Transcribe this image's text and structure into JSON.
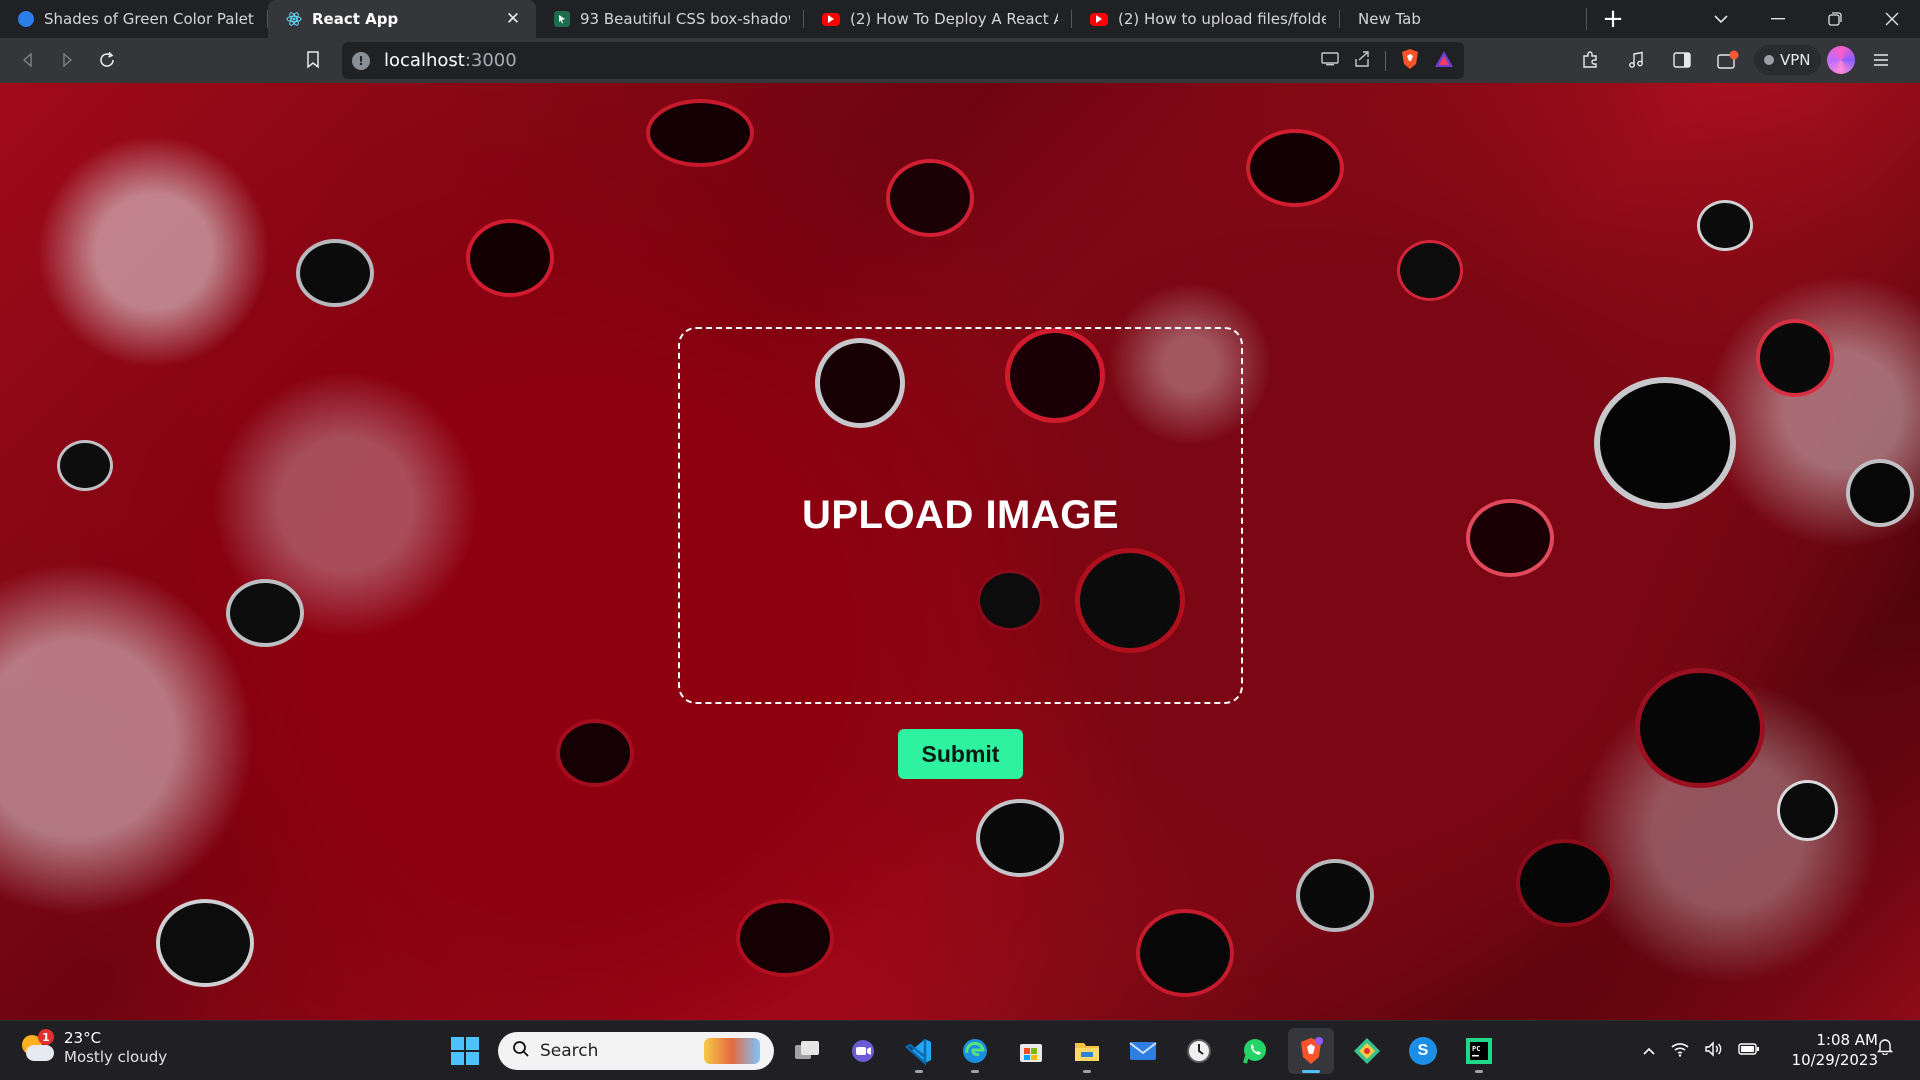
{
  "browser": {
    "tabs": [
      {
        "title": "Shades of Green Color Palettes –",
        "active": false,
        "favicon": "palette-favicon",
        "color": "#2b7de9"
      },
      {
        "title": "React App",
        "active": true,
        "favicon": "react-favicon",
        "color": "#61dafb"
      },
      {
        "title": "93 Beautiful CSS box-shadow exa",
        "active": false,
        "favicon": "cursor-favicon",
        "color": "#1f6b4e"
      },
      {
        "title": "(2) How To Deploy A React App T",
        "active": false,
        "favicon": "youtube-favicon",
        "color": "#ff0000"
      },
      {
        "title": "(2) How to upload files/folders/p",
        "active": false,
        "favicon": "youtube-favicon",
        "color": "#ff0000"
      },
      {
        "title": "New Tab",
        "active": false,
        "favicon": "",
        "color": ""
      }
    ],
    "close_glyph": "✕",
    "new_tab_glyph": "+",
    "address": {
      "host": "localhost",
      "port": ":3000"
    },
    "vpn_label": "VPN"
  },
  "page": {
    "upload_label": "UPLOAD IMAGE",
    "submit_label": "Submit",
    "accent_color": "#2ef2a0"
  },
  "taskbar": {
    "weather": {
      "temp": "23°C",
      "condition": "Mostly cloudy",
      "badge": "1"
    },
    "search_label": "Search",
    "clock": {
      "time": "1:08 AM",
      "date": "10/29/2023"
    }
  }
}
